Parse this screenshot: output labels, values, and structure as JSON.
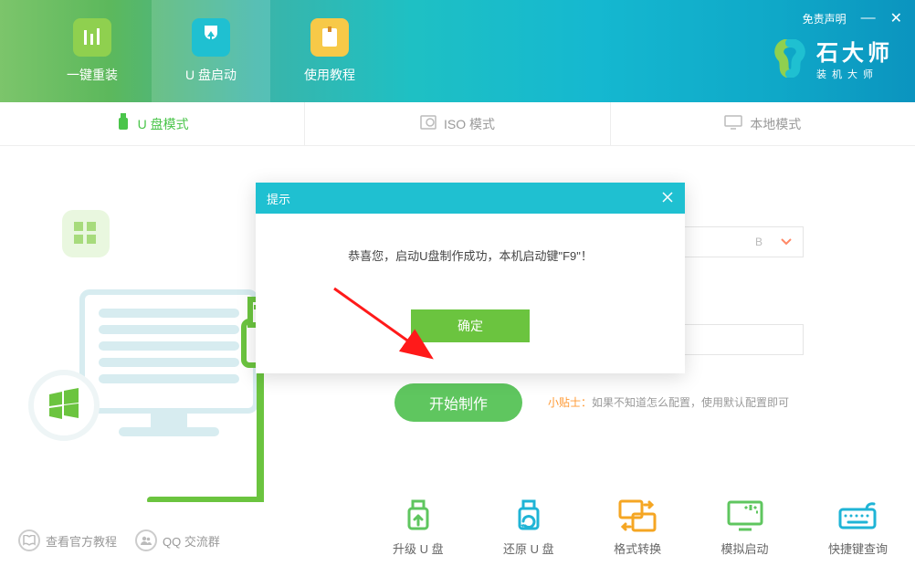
{
  "window": {
    "disclaimer": "免责声明",
    "minimize": "—",
    "close": "✕"
  },
  "brand": {
    "title": "石大师",
    "subtitle": "装机大师"
  },
  "nav": [
    {
      "label": "一键重装",
      "active": false
    },
    {
      "label": "U 盘启动",
      "active": true
    },
    {
      "label": "使用教程",
      "active": false
    }
  ],
  "mode_tabs": [
    {
      "label": "U 盘模式",
      "active": true
    },
    {
      "label": "ISO 模式",
      "active": false
    },
    {
      "label": "本地模式",
      "active": false
    }
  ],
  "dropdown1_value": "B",
  "main_button": "开始制作",
  "hint": {
    "label": "小贴士：",
    "text": "如果不知道怎么配置，使用默认配置即可"
  },
  "actions": [
    {
      "label": "升级 U 盘"
    },
    {
      "label": "还原 U 盘"
    },
    {
      "label": "格式转换"
    },
    {
      "label": "模拟启动"
    },
    {
      "label": "快捷键查询"
    }
  ],
  "footer": [
    {
      "label": "查看官方教程"
    },
    {
      "label": "QQ 交流群"
    }
  ],
  "modal": {
    "title": "提示",
    "message": "恭喜您，启动U盘制作成功，本机启动键\"F9\"！",
    "ok": "确定"
  }
}
